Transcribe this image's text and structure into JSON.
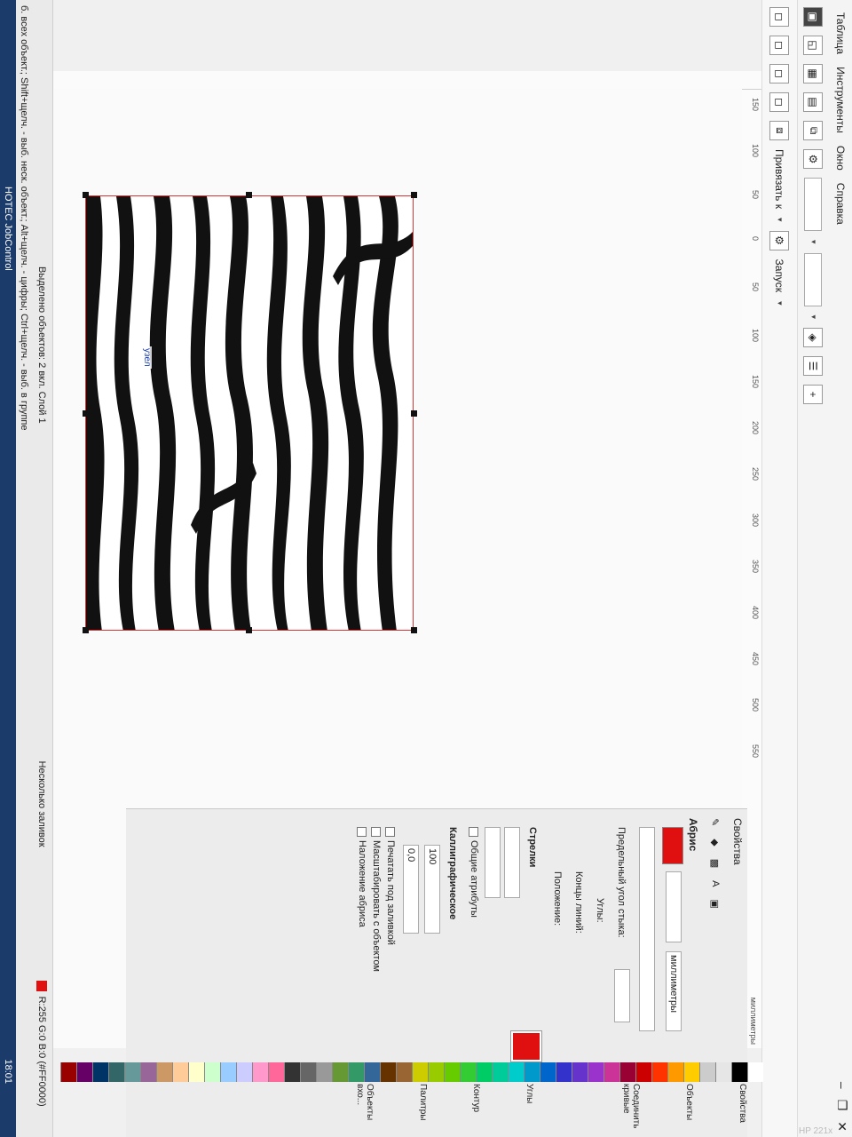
{
  "menu": [
    "Таблица",
    "Инструменты",
    "Окно",
    "Справка"
  ],
  "toolbar": {
    "snap_label": "Привязать к",
    "launch_label": "Запуск"
  },
  "ruler": {
    "ticks": [
      "150",
      "100",
      "50",
      "0",
      "50",
      "100",
      "150",
      "200",
      "250",
      "300",
      "350",
      "400",
      "450",
      "500",
      "550"
    ],
    "unit": "миллиметры"
  },
  "canvas": {
    "node_label": "узел"
  },
  "docker": {
    "title": "Свойства",
    "outline_heading": "Абрис",
    "units": "миллиметры",
    "miter_label": "Предельный угол стыка:",
    "corners_label": "Углы:",
    "line_caps_label": "Концы линий:",
    "position_label": "Положение:",
    "arrows_label": "Стрелки",
    "common_attrs_label": "Общие атрибуты",
    "calligraphic_label": "Каллиграфическое",
    "stretch_value": "100",
    "angle_value": "0,0",
    "print_under_fill": "Печатать под заливкой",
    "scale_with_object": "Масштабировать с объектом",
    "overprint_outline": "Наложение абриса"
  },
  "tabs": [
    "Свойства",
    "Объекты",
    "Соединить кривые",
    "Углы",
    "Контур",
    "Палитры",
    "Объекты вхо..."
  ],
  "status": {
    "selection": "Выделено объектов: 2 вкл. Слой 1",
    "fill": "Несколько заливок",
    "outline_color": "R:255 G:0 B:0 (#FF0000)",
    "hint": "б. всех объект.; Shift+щелч. - выб. неск. объект.; Alt+щелч. - цифры; Ctrl+щелч. - выб. в группе"
  },
  "taskbar": {
    "app": "HOTEC JobControl",
    "time": "18:01",
    "monitor": "HP 221x"
  },
  "colors": {
    "outline_red": "#e01010",
    "accent": "#1b3b6a"
  }
}
